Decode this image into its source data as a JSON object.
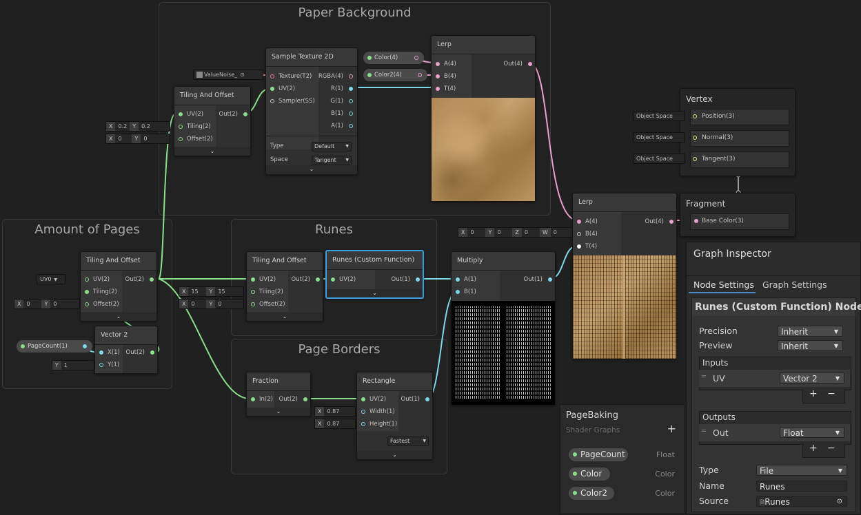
{
  "groups": {
    "paper": "Paper Background",
    "amount": "Amount of Pages",
    "runes": "Runes",
    "borders": "Page Borders"
  },
  "nodes": {
    "sample_texture": {
      "title": "Sample Texture 2D",
      "in": [
        "Texture(T2)",
        "UV(2)",
        "Sampler(SS)"
      ],
      "out": [
        "RGBA(4)",
        "R(1)",
        "G(1)",
        "B(1)",
        "A(1)"
      ],
      "type_label": "Type",
      "type_value": "Default",
      "space_label": "Space",
      "space_value": "Tangent",
      "texture_input": "ValueNoise_"
    },
    "tiling_paper": {
      "title": "Tiling And Offset",
      "in": [
        "UV(2)",
        "Tiling(2)",
        "Offset(2)"
      ],
      "out": "Out(2)",
      "tiling_x": "0.2",
      "tiling_y": "0.2",
      "offset_x": "0",
      "offset_y": "0"
    },
    "lerp_top": {
      "title": "Lerp",
      "in": [
        "A(4)",
        "B(4)",
        "T(4)"
      ],
      "out": "Out(4)"
    },
    "color1": "Color(4)",
    "color2": "Color2(4)",
    "vertex": {
      "title": "Vertex",
      "ports": [
        "Position(3)",
        "Normal(3)",
        "Tangent(3)"
      ],
      "space": "Object Space"
    },
    "fragment": {
      "title": "Fragment",
      "ports": [
        "Base Color(3)"
      ]
    },
    "lerp_main": {
      "title": "Lerp",
      "in": [
        "A(4)",
        "B(4)",
        "T(4)"
      ],
      "out": "Out(4)",
      "b_x": "0",
      "b_y": "0",
      "b_z": "0",
      "b_w": "0"
    },
    "tiling_pages": {
      "title": "Tiling And Offset",
      "in": [
        "UV(2)",
        "Tiling(2)",
        "Offset(2)"
      ],
      "out": "Out(2)",
      "uv_select": "UV0",
      "offset_x": "0",
      "offset_y": "0"
    },
    "vector2": {
      "title": "Vector 2",
      "in": [
        "X(1)",
        "Y(1)"
      ],
      "out": "Out(2)",
      "y_value": "1"
    },
    "pagecount": "PageCount(1)",
    "tiling_runes": {
      "title": "Tiling And Offset",
      "in": [
        "UV(2)",
        "Tiling(2)",
        "Offset(2)"
      ],
      "out": "Out(2)",
      "tiling_x": "15",
      "tiling_y": "15",
      "offset_x": "0",
      "offset_y": "0"
    },
    "runes_fn": {
      "title": "Runes (Custom Function)",
      "in": "UV(2)",
      "out": "Out(1)"
    },
    "multiply": {
      "title": "Multiply",
      "in": [
        "A(1)",
        "B(1)"
      ],
      "out": "Out(1)"
    },
    "fraction": {
      "title": "Fraction",
      "in": "In(2)",
      "out": "Out(2)"
    },
    "rectangle": {
      "title": "Rectangle",
      "in": [
        "UV(2)",
        "Width(1)",
        "Height(1)"
      ],
      "out": "Out(1)",
      "width": "0.87",
      "height": "0.87",
      "mode": "Fastest"
    }
  },
  "axis": {
    "x": "X",
    "y": "Y",
    "z": "Z",
    "w": "W"
  },
  "blackboard": {
    "title": "PageBaking",
    "subtitle": "Shader Graphs",
    "add": "+",
    "properties": [
      {
        "name": "PageCount",
        "type": "Float"
      },
      {
        "name": "Color",
        "type": "Color"
      },
      {
        "name": "Color2",
        "type": "Color"
      }
    ]
  },
  "inspector": {
    "title": "Graph Inspector",
    "tabs": [
      "Node Settings",
      "Graph Settings"
    ],
    "node_title": "Runes (Custom Function) Node",
    "precision_label": "Precision",
    "precision_value": "Inherit",
    "preview_label": "Preview",
    "preview_value": "Inherit",
    "inputs_label": "Inputs",
    "input_name": "UV",
    "input_type": "Vector 2",
    "outputs_label": "Outputs",
    "output_name": "Out",
    "output_type": "Float",
    "type_label": "Type",
    "type_value": "File",
    "name_label": "Name",
    "name_value": "Runes",
    "source_label": "Source",
    "source_value": "Runes",
    "plus": "+",
    "minus": "−"
  },
  "colors": {
    "wire_green": "#8ae08a",
    "wire_cyan": "#7fd8e8",
    "wire_pink": "#e9a0cf",
    "selection": "#3aa0e0"
  }
}
